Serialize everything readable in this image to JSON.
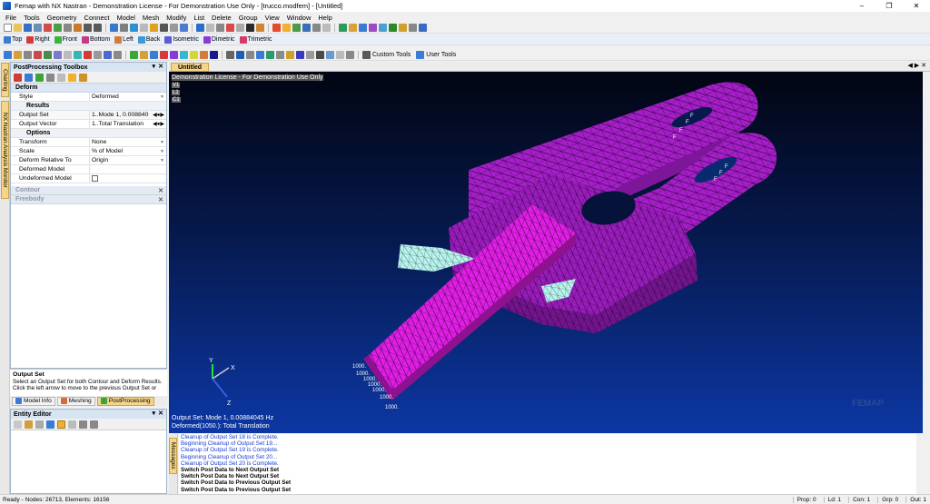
{
  "window": {
    "title": "Femap with NX Nastran - Demonstration License - For Demonstration Use Only - [trucco.modfem] - [Untitled]"
  },
  "menu": [
    "File",
    "Tools",
    "Geometry",
    "Connect",
    "Model",
    "Mesh",
    "Modify",
    "List",
    "Delete",
    "Group",
    "View",
    "Window",
    "Help"
  ],
  "view_toolbar": [
    "Top",
    "Right",
    "Front",
    "Bottom",
    "Left",
    "Back",
    "Isometric",
    "Dimetric",
    "Trimetric"
  ],
  "toolbar3": {
    "custom_tools": "Custom Tools",
    "user_tools": "User Tools"
  },
  "side_tabs": {
    "charting": "Charting",
    "monitor": "NX Nastran Analysis Monitor"
  },
  "toolbox": {
    "title": "PostProcessing Toolbox",
    "deform": {
      "header": "Deform",
      "style_label": "Style",
      "style_value": "Deformed",
      "results_header": "Results",
      "output_set_label": "Output Set",
      "output_set_value": "1..Mode 1, 0.008840",
      "output_vector_label": "Output Vector",
      "output_vector_value": "1..Total Translation",
      "options_header": "Options",
      "transform_label": "Transform",
      "transform_value": "None",
      "scale_label": "Scale",
      "scale_value": "% of Model",
      "relative_label": "Deform Relative To",
      "relative_value": "Origin",
      "deformed_model_label": "Deformed Model",
      "undeformed_model_label": "Undeformed Model"
    },
    "contour": "Contour",
    "freebody": "Freebody"
  },
  "help": {
    "title": "Output Set",
    "text": "Select an Output Set for both Contour and Deform Results. Click the left arrow to move to the previous Output Set or"
  },
  "bottom_tabs": [
    "Model Info",
    "Meshing",
    "PostProcessing"
  ],
  "entity_editor": {
    "title": "Entity Editor"
  },
  "doc_tab": "Untitled",
  "viewport": {
    "license_text": "Demonstration License - For Demonstration Use Only",
    "corner_labels": [
      "V1",
      "L1",
      "C1"
    ],
    "output_line1": "Output Set: Mode 1, 0.00884045 Hz",
    "output_line2": "Deformed(1050.): Total Translation",
    "axes": {
      "x": "X",
      "y": "Y",
      "z": "Z"
    },
    "load_labels": [
      "1000.",
      "1000.",
      "1000.",
      "1000.",
      "1000.",
      "1000.",
      "1000."
    ],
    "constraint_label": "F",
    "watermark": "FEMAP"
  },
  "messages": {
    "tab": "Messages",
    "lines": [
      {
        "text": "Cleanup of Output Set 18 is Complete.",
        "bold": false
      },
      {
        "text": "Beginning Cleanup of Output Set 19...",
        "bold": false
      },
      {
        "text": "Cleanup of Output Set 19 is Complete.",
        "bold": false
      },
      {
        "text": "Beginning Cleanup of Output Set 20...",
        "bold": false
      },
      {
        "text": "Cleanup of Output Set 20 is Complete.",
        "bold": false
      },
      {
        "text": "Switch Post Data to Next Output Set",
        "bold": true
      },
      {
        "text": "Switch Post Data to Next Output Set",
        "bold": true
      },
      {
        "text": "Switch Post Data to Previous Output Set",
        "bold": true
      },
      {
        "text": "Switch Post Data to Previous Output Set",
        "bold": true
      }
    ]
  },
  "status": {
    "left": "Ready - Nodes: 26713,  Elements: 16156",
    "prop": "Prop: 0",
    "ld": "Ld: 1",
    "con": "Con: 1",
    "grp": "Grp: 0",
    "out": "Out: 1"
  },
  "colors": {
    "mesh_body": "#a51ec8",
    "mesh_pin": "#e21ee6",
    "mesh_plate": "#b9f3ec",
    "tab_active": "#f5d58a"
  }
}
